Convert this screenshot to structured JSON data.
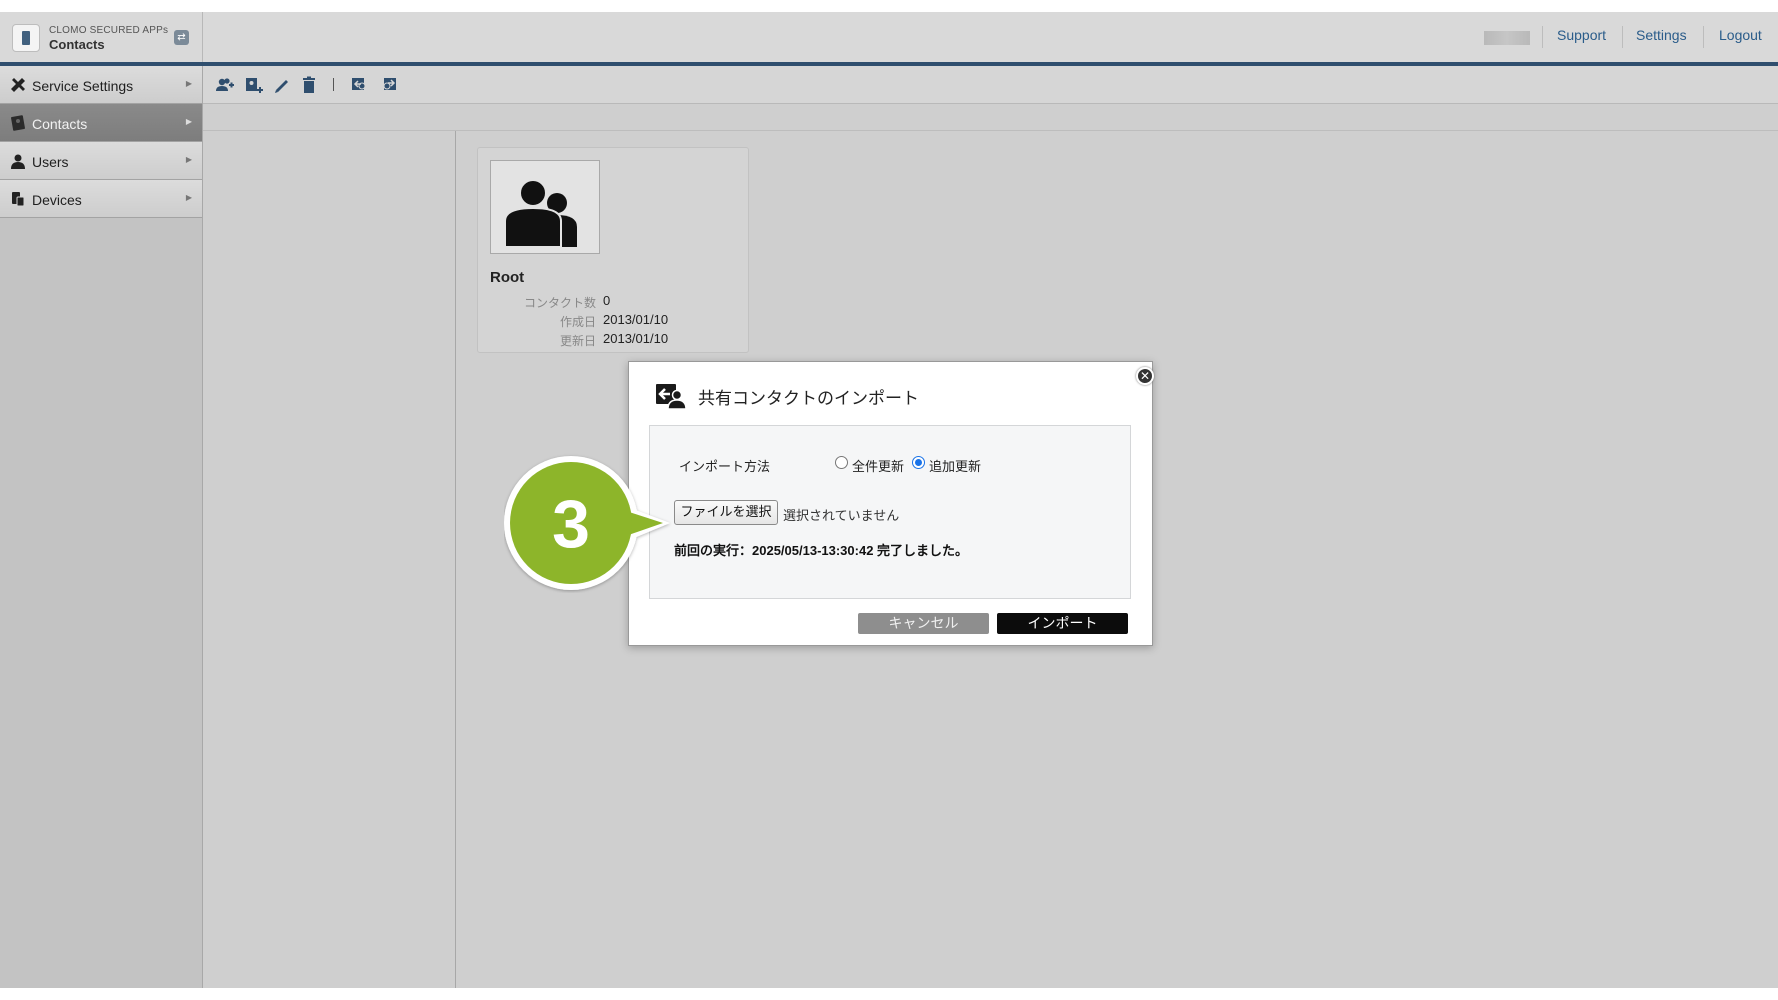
{
  "header": {
    "brand_top": "CLOMO SECURED APPs",
    "brand_name": "Contacts",
    "links": {
      "support": "Support",
      "settings": "Settings",
      "logout": "Logout"
    }
  },
  "toolbar": {
    "buttons": [
      "add-contact-icon",
      "add-group-icon",
      "edit-icon",
      "trash-icon",
      "import-icon",
      "export-icon"
    ]
  },
  "sidebar": {
    "items": [
      {
        "label": "Service Settings",
        "icon": "tools-icon",
        "active": false
      },
      {
        "label": "Contacts",
        "icon": "contacts-book-icon",
        "active": true
      },
      {
        "label": "Users",
        "icon": "user-icon",
        "active": false
      },
      {
        "label": "Devices",
        "icon": "devices-icon",
        "active": false
      }
    ]
  },
  "root_card": {
    "name": "Root",
    "rows": [
      {
        "label": "コンタクト数",
        "value": "0"
      },
      {
        "label": "作成日",
        "value": "2013/01/10"
      },
      {
        "label": "更新日",
        "value": "2013/01/10"
      }
    ]
  },
  "modal": {
    "title": "共有コンタクトのインポート",
    "method_label": "インポート方法",
    "options": [
      {
        "label": "全件更新",
        "checked": false
      },
      {
        "label": "追加更新",
        "checked": true
      }
    ],
    "file_button": "ファイルを選択",
    "file_status": "選択されていません",
    "last_run": "前回の実行：2025/05/13-13:30:42 完了しました。",
    "cancel": "キャンセル",
    "import": "インポート",
    "close_glyph": "✕"
  },
  "callout": {
    "number": "3",
    "color": "#8db52b"
  },
  "colors": {
    "header_rule": "#2f4e6e",
    "link": "#2a5c8a",
    "radio_checked": "#1a73e8"
  }
}
